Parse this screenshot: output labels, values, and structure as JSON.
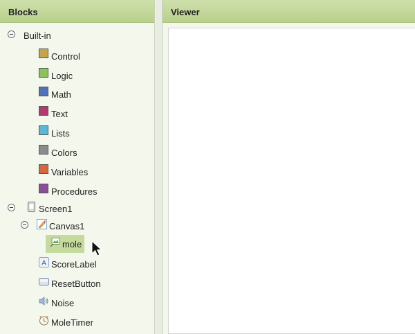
{
  "blocks_panel": {
    "title": "Blocks"
  },
  "viewer_panel": {
    "title": "Viewer"
  },
  "builtin": {
    "label": "Built-in",
    "items": [
      {
        "label": "Control",
        "color": "#c6a44c"
      },
      {
        "label": "Logic",
        "color": "#8cc25c"
      },
      {
        "label": "Math",
        "color": "#4f72ba"
      },
      {
        "label": "Text",
        "color": "#b23a6c"
      },
      {
        "label": "Lists",
        "color": "#5bb7d8"
      },
      {
        "label": "Colors",
        "color": "#8b8b8b"
      },
      {
        "label": "Variables",
        "color": "#d8663a"
      },
      {
        "label": "Procedures",
        "color": "#8a4d98"
      }
    ]
  },
  "components": {
    "screen": {
      "label": "Screen1",
      "icon": "screen-icon"
    },
    "canvas": {
      "label": "Canvas1",
      "icon": "canvas-icon"
    },
    "mole": {
      "label": "mole",
      "icon": "image-sprite-icon"
    },
    "others": [
      {
        "label": "ScoreLabel",
        "icon": "label-icon"
      },
      {
        "label": "ResetButton",
        "icon": "button-icon"
      },
      {
        "label": "Noise",
        "icon": "sound-icon"
      },
      {
        "label": "MoleTimer",
        "icon": "clock-icon"
      }
    ]
  }
}
